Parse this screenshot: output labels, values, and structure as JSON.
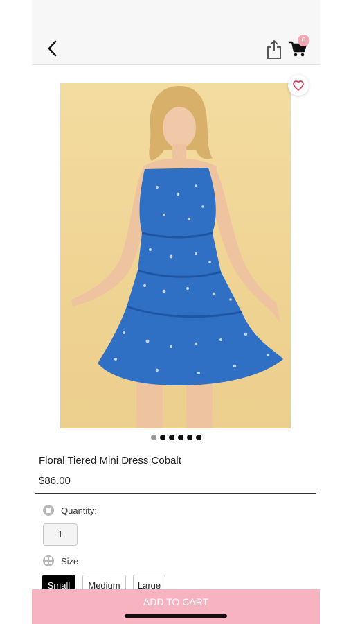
{
  "header": {
    "back_icon": "chevron-left-icon",
    "share_icon": "share-icon",
    "cart_icon": "cart-icon",
    "cart_count": "0"
  },
  "product": {
    "title": "Floral Tiered Mini Dress Cobalt",
    "price": "$86.00",
    "image_alt": "Model wearing blue floral tiered mini dress",
    "image_count": 6,
    "active_image_index": 0
  },
  "options": {
    "quantity_label": "Quantity:",
    "quantity_value": "1",
    "size_label": "Size",
    "sizes": [
      "Small",
      "Medium",
      "Large"
    ],
    "selected_size": "Small"
  },
  "actions": {
    "add_to_cart": "ADD TO CART"
  },
  "colors": {
    "accent_pink": "#f8b3c1",
    "badge_pink": "#f4a6b4",
    "dress_blue": "#2f6fc4",
    "backdrop": "#efd393"
  }
}
